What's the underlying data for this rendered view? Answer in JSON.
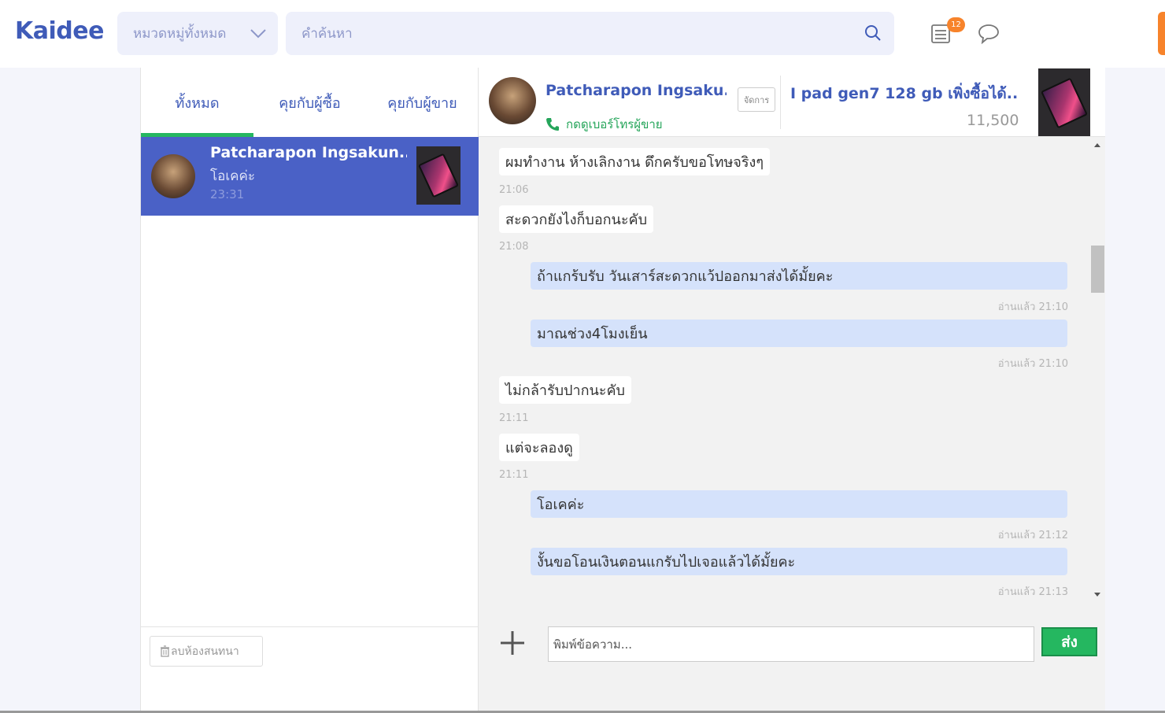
{
  "header": {
    "logo": "Kaidee",
    "category_select": "หมวดหมู่ทั้งหมด",
    "search_placeholder": "คำค้นหา",
    "notification_count": "12"
  },
  "colors": {
    "brand_blue": "#3f5bb8",
    "selected_conversation": "#4a61c6",
    "accent_green": "#25b760",
    "accent_orange": "#f7832b",
    "outgoing_bubble": "#d5e2fb"
  },
  "tabs": [
    {
      "label": "ทั้งหมด",
      "active": true
    },
    {
      "label": "คุยกับผู้ซื้อ",
      "active": false
    },
    {
      "label": "คุยกับผู้ขาย",
      "active": false
    }
  ],
  "conversation": {
    "name": "Patcharapon Ingsakun...",
    "last_message": "โอเคค่ะ",
    "time": "23:31"
  },
  "delete_room_label": "ลบห้องสนทนา",
  "chat_header": {
    "name": "Patcharapon Ingsaku...",
    "phone_link": "กดดูเบอร์โทรผู้ขาย",
    "manage_label": "จัดการ",
    "product_title": "I pad gen7 128 gb เพิ่งซื้อได้...",
    "product_price": "11,500"
  },
  "messages": [
    {
      "dir": "in",
      "text": "ผมทำงาน ห้างเลิกงาน ดึกครับขอโทษจริงๆ",
      "time": "21:06"
    },
    {
      "dir": "in",
      "text": "สะดวกยังไงก็บอกนะคับ",
      "time": "21:08"
    },
    {
      "dir": "out",
      "text": "ถ้าแกร้บรับ วันเสาร์สะดวกแว้ปออกมาส่งได้มั้ยคะ",
      "time": "อ่านแล้ว 21:10"
    },
    {
      "dir": "out",
      "text": "มาณช่วง4โมงเย็น",
      "time": "อ่านแล้ว 21:10"
    },
    {
      "dir": "in",
      "text": "ไม่กล้ารับปากนะคับ",
      "time": "21:11"
    },
    {
      "dir": "in",
      "text": "แต่จะลองดู",
      "time": "21:11"
    },
    {
      "dir": "out",
      "text": "โอเคค่ะ",
      "time": "อ่านแล้ว 21:12"
    },
    {
      "dir": "out",
      "text": "งั้นขอโอนเงินตอนแกรับไปเจอแล้วได้มั้ยคะ",
      "time": "อ่านแล้ว 21:13"
    }
  ],
  "composer": {
    "placeholder": "พิมพ์ข้อความ...",
    "send_label": "ส่ง"
  }
}
